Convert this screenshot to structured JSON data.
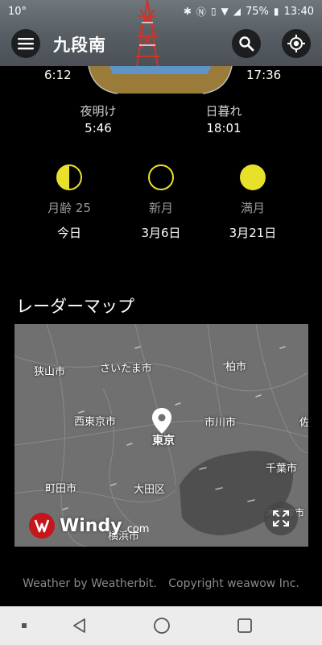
{
  "status_bar": {
    "temperature": "10°",
    "battery": "75%",
    "time": "13:40"
  },
  "app_bar": {
    "location": "九段南"
  },
  "sun": {
    "sunrise": "6:12",
    "sunset": "17:36",
    "dawn_label": "夜明け",
    "dawn_time": "5:46",
    "dusk_label": "日暮れ",
    "dusk_time": "18:01"
  },
  "moon": [
    {
      "label": "月齢 25",
      "date": "今日",
      "phase": "last-quarter"
    },
    {
      "label": "新月",
      "date": "3月6日",
      "phase": "new"
    },
    {
      "label": "満月",
      "date": "3月21日",
      "phase": "full"
    }
  ],
  "moon_color": "#e8e12a",
  "radar": {
    "heading": "レーダーマップ",
    "places": {
      "sayama": "狭山市",
      "saitama": "さいたま市",
      "kashiwa": "柏市",
      "nishitokyo": "西東京市",
      "tokyo": "東京",
      "ichikawa": "市川市",
      "chiba": "千葉市",
      "machida": "町田市",
      "ota": "大田区",
      "yokohama": "横浜市",
      "kisarazu": "木更津市",
      "sakura": "佐"
    },
    "windy_brand": "Windy",
    "windy_com": ".com"
  },
  "credits": {
    "weather": "Weather by Weatherbit.",
    "copyright": "Copyright weawow Inc."
  }
}
